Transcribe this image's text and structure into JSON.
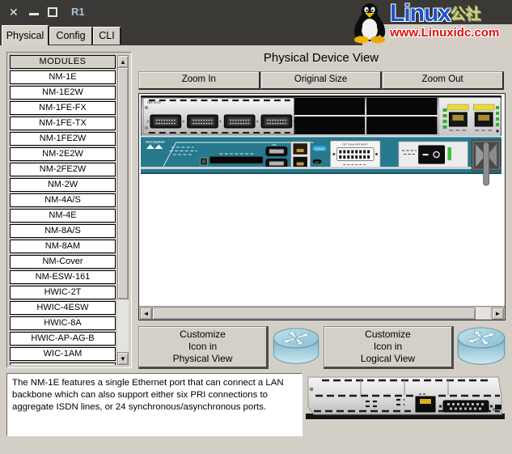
{
  "titlebar": {
    "title": "R1"
  },
  "watermark": {
    "brand": "Linux",
    "brand_cjk": "公社",
    "url": "www.Linuxidc.com"
  },
  "tabs": {
    "physical": "Physical",
    "config": "Config",
    "cli": "CLI",
    "active": "Physical"
  },
  "modules": {
    "header": "MODULES",
    "items": [
      "NM-1E",
      "NM-1E2W",
      "NM-1FE-FX",
      "NM-1FE-TX",
      "NM-1FE2W",
      "NM-2E2W",
      "NM-2FE2W",
      "NM-2W",
      "NM-4A/S",
      "NM-4E",
      "NM-8A/S",
      "NM-8AM",
      "NM-Cover",
      "NM-ESW-161",
      "HWIC-2T",
      "HWIC-4ESW",
      "HWIC-8A",
      "HWIC-AP-AG-B",
      "WIC-1AM"
    ]
  },
  "physical_view": {
    "title": "Physical Device View",
    "zoom_in": "Zoom In",
    "original_size": "Original Size",
    "zoom_out": "Zoom Out"
  },
  "device": {
    "slot_module_label": "NM-4A/S",
    "brand_logo": "Cisco Systems",
    "console_badge": "CONSOLE",
    "aux_badge": "AUX",
    "usb_label": "USB",
    "rps_label": "OPT. DUAL RPS INPUT"
  },
  "customize": {
    "physical": "Customize\nIcon in\nPhysical View",
    "logical": "Customize\nIcon in\nLogical View"
  },
  "description": {
    "text": "The NM-1E features a single Ethernet port that can connect a LAN backbone which can also support either six PRI connections to aggregate ISDN lines, or 24 synchronous/asynchronous ports."
  },
  "colors": {
    "window_bg": "#d3cfc7",
    "titlebar_bg": "#3a3935",
    "router_teal": "#27798d",
    "led_green": "#2fae2f",
    "port_label_yellow": "#e8d840",
    "brand_blue": "#1a53d0",
    "brand_red": "#e01010",
    "brand_yellow": "#cdd088"
  }
}
